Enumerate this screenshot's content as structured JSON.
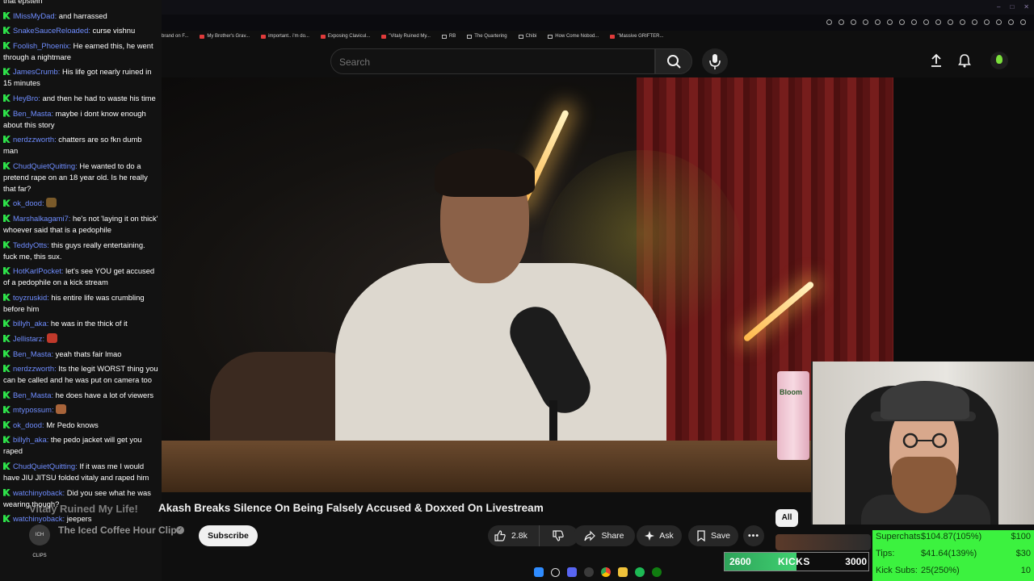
{
  "browser": {
    "bookmarks": [
      {
        "label": "brand on F..."
      },
      {
        "label": "My Brother's Grav..."
      },
      {
        "label": "important.. i'm do..."
      },
      {
        "label": "Exposing Clavicul..."
      },
      {
        "label": "\"Vitaly Ruined My..."
      },
      {
        "label": "RB"
      },
      {
        "label": "The Quartering"
      },
      {
        "label": "Chibi"
      },
      {
        "label": "How Come Nobod..."
      },
      {
        "label": "\"Massive GRIFTER..."
      }
    ],
    "window_controls": [
      "–",
      "□",
      "✕"
    ]
  },
  "chat": {
    "messages": [
      {
        "user": "",
        "text": "that epstein"
      },
      {
        "user": "IMissMyDad",
        "text": "and harrassed"
      },
      {
        "user": "SnakeSauceReloaded",
        "text": "curse vishnu"
      },
      {
        "user": "Foolish_Phoenix",
        "text": "He earned this, he went through a nightmare"
      },
      {
        "user": "JamesCrumb",
        "text": "His life got nearly ruined in 15 minutes"
      },
      {
        "user": "HeyBro",
        "text": "and then he had to waste his time"
      },
      {
        "user": "Ben_Masta",
        "text": "maybe i dont know enough about this story"
      },
      {
        "user": "nerdzzworth",
        "text": "chatters are so fkn dumb man"
      },
      {
        "user": "ChudQuietQuitting",
        "text": "He wanted to do a pretend rape on an 18 year old. Is he really that far?"
      },
      {
        "user": "ok_dood",
        "text": "",
        "emote": "#7a5a2a"
      },
      {
        "user": "Marshalkagami7",
        "text": "he's not 'laying it on thick' whoever said that is a pedophile"
      },
      {
        "user": "TeddyOtts",
        "text": "this guys really entertaining. fuck me, this sux."
      },
      {
        "user": "HotKarlPocket",
        "text": "let's see YOU get accused of a pedophile on a kick stream"
      },
      {
        "user": "toyzruskid",
        "text": "his entire life was crumbling before him"
      },
      {
        "user": "billyh_aka",
        "text": "he was in the thick of it"
      },
      {
        "user": "Jellistarz",
        "text": "",
        "emote": "#c0392b"
      },
      {
        "user": "Ben_Masta",
        "text": "yeah thats fair lmao"
      },
      {
        "user": "nerdzzworth",
        "text": "Its the legit WORST thing you can be called and he was put on camera too"
      },
      {
        "user": "Ben_Masta",
        "text": "he does have a lot of viewers"
      },
      {
        "user": "mtypossum",
        "text": "",
        "emote": "#a8643a"
      },
      {
        "user": "ok_dood",
        "text": "Mr Pedo knows"
      },
      {
        "user": "billyh_aka",
        "text": "the pedo jacket will get you raped"
      },
      {
        "user": "ChudQuietQuitting",
        "text": "If it was me I would have JIU JITSU folded vitaly and raped him"
      },
      {
        "user": "watchinyoback",
        "text": "Did you see what he was wearing though?"
      },
      {
        "user": "watchinyoback",
        "text": "jeepers"
      }
    ]
  },
  "header": {
    "search_placeholder": "Search"
  },
  "video": {
    "can_label": "Bloom",
    "title": "Akash Breaks Silence On Being Falsely Accused & Doxxed On Livestream",
    "overlay_title": "Vitaly Ruined My Life!",
    "channel_avatar_text": "ICH CLIPS",
    "channel": "The Iced Coffee Hour Clips",
    "verified_mark": "✓",
    "subscribe_label": "Subscribe",
    "likes": "2.8k",
    "share_label": "Share",
    "ask_label": "Ask",
    "save_label": "Save",
    "more_label": "•••",
    "chip_all": "All"
  },
  "overlay": {
    "kicks_left": "2600",
    "kicks_label": "KICKS",
    "kicks_right": "3000",
    "kicks_progress": 0.5,
    "donations": [
      {
        "label": "Superchats:",
        "value": "$104.87(105%)",
        "goal": "$100"
      },
      {
        "label": "Tips:",
        "value": "$41.64(139%)",
        "goal": "$30"
      },
      {
        "label": "Kick Subs:",
        "value": "25(250%)",
        "goal": "10"
      }
    ]
  },
  "colors": {
    "chat_user": "#6f8dff",
    "kick_green": "#2ee24a",
    "donation_bg": "#3cf23f"
  },
  "taskbar": {
    "icons": [
      "windows-start-icon",
      "search-icon",
      "discord-icon",
      "obs-icon",
      "chrome-icon",
      "folder-icon",
      "spotify-icon",
      "xbox-icon"
    ]
  }
}
